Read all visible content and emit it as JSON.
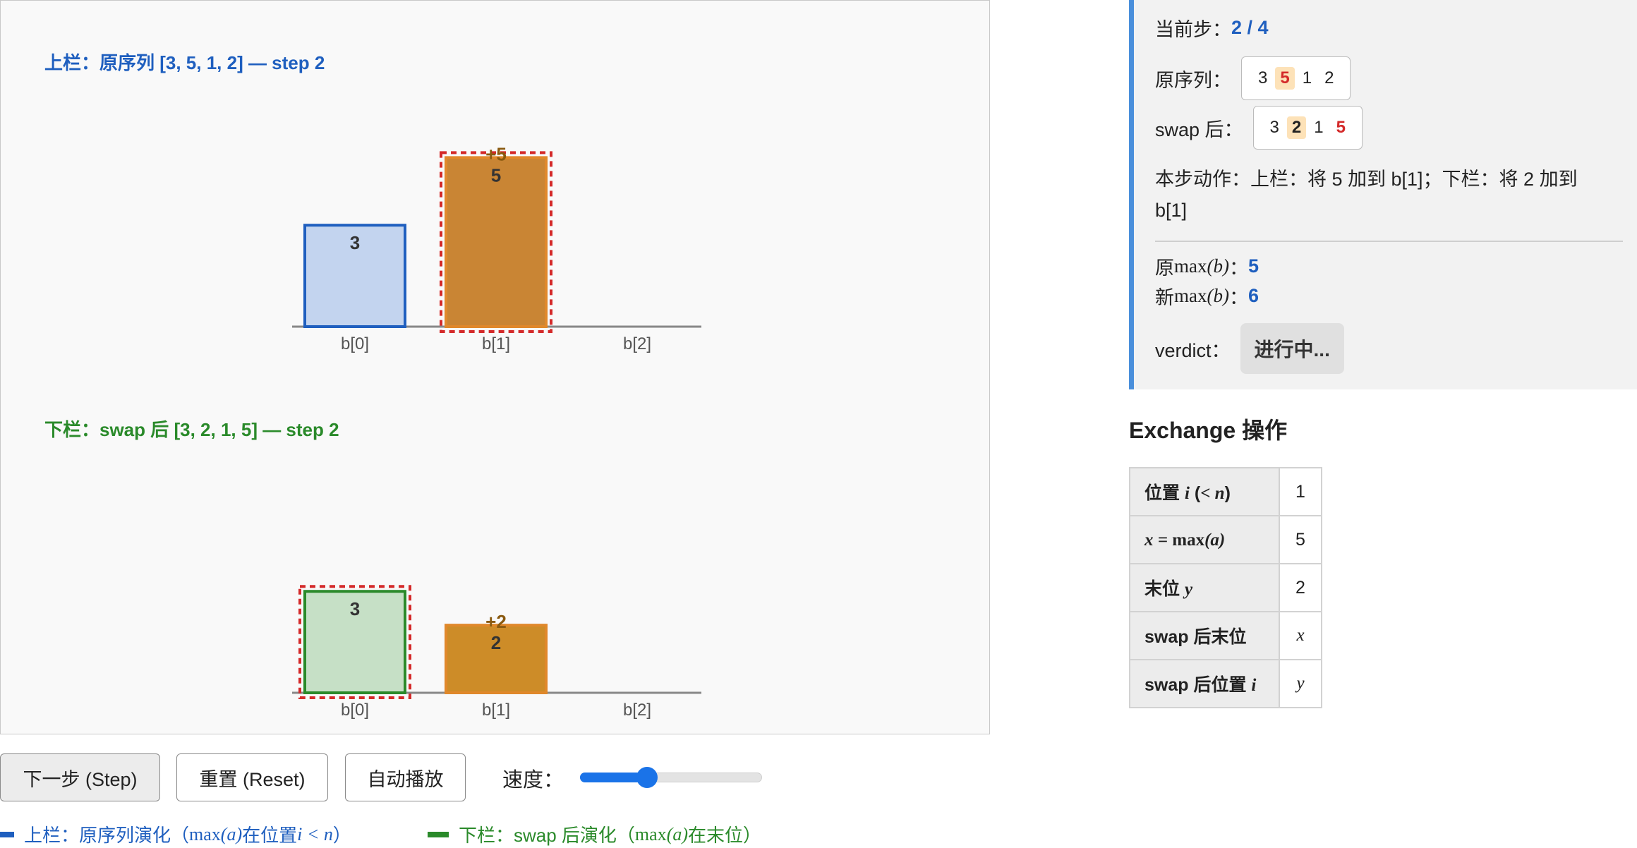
{
  "canvas": {
    "top_title": "上栏：原序列 [3, 5, 1, 2] — step 2",
    "bottom_title": "下栏：swap 后 [3, 2, 1, 5] — step 2"
  },
  "chart_data": [
    {
      "type": "bar",
      "categories": [
        "b[0]",
        "b[1]",
        "b[2]"
      ],
      "values": [
        3,
        5,
        0
      ],
      "value_labels": [
        "3",
        "5",
        ""
      ],
      "increments": [
        "",
        "+5",
        ""
      ],
      "highlighted_index": 1,
      "colors": [
        "#c3d4ef",
        "#c98534",
        null
      ],
      "edge_colors": [
        "#1f5fbf",
        "#e0882b",
        null
      ],
      "highlight_color": "#d42a2a",
      "ylim": [
        0,
        5.3
      ]
    },
    {
      "type": "bar",
      "categories": [
        "b[0]",
        "b[1]",
        "b[2]"
      ],
      "values": [
        3,
        2,
        0
      ],
      "value_labels": [
        "3",
        "2",
        ""
      ],
      "increments": [
        "",
        "+2",
        ""
      ],
      "highlighted_index": 0,
      "colors": [
        "#c6e0c6",
        "#cd8c28",
        null
      ],
      "edge_colors": [
        "#2a8a2a",
        "#e0882b",
        null
      ],
      "highlight_color": "#d42a2a",
      "ylim": [
        0,
        5.3
      ]
    }
  ],
  "controls": {
    "step_label": "下一步 (Step)",
    "reset_label": "重置 (Reset)",
    "auto_label": "自动播放",
    "speed_label": "速度：",
    "speed_value": 0.35
  },
  "legend": {
    "top_pre": "上栏：原序列演化（",
    "top_post": " 在位置 ",
    "top_end": "）",
    "bottom_pre": "下栏：swap 后演化（",
    "bottom_post": " 在末位）"
  },
  "info": {
    "step_label": "当前步：",
    "step_value": "2 / 4",
    "orig_label": "原序列：",
    "orig_seq": [
      "3",
      "5",
      "1",
      "2"
    ],
    "swap_label": "swap 后：",
    "swap_seq": [
      "3",
      "2",
      "1",
      "5"
    ],
    "action_text": "本步动作：上栏：将 5 加到 b[1]；下栏：将 2 加到 b[1]",
    "orig_max_prefix": "原 ",
    "orig_max_value": "5",
    "new_max_prefix": "新 ",
    "new_max_value": "6",
    "verdict_label": "verdict：",
    "verdict_value": "进行中..."
  },
  "exchange": {
    "title": "Exchange 操作",
    "rows": [
      {
        "key_text": "位置 ",
        "value": "1"
      },
      {
        "key_text": "",
        "value": "5"
      },
      {
        "key_text": "末位 ",
        "value": "2"
      },
      {
        "key_text": "swap 后末位",
        "value": "x"
      },
      {
        "key_text": "swap 后位置 ",
        "value": "y"
      }
    ]
  },
  "colors": {
    "accent_blue": "#1f5fbf",
    "accent_green": "#2a8a2a",
    "highlight_red": "#d42a2a",
    "slider_blue": "#1a73e8",
    "panel_border": "#4a8fdb"
  }
}
